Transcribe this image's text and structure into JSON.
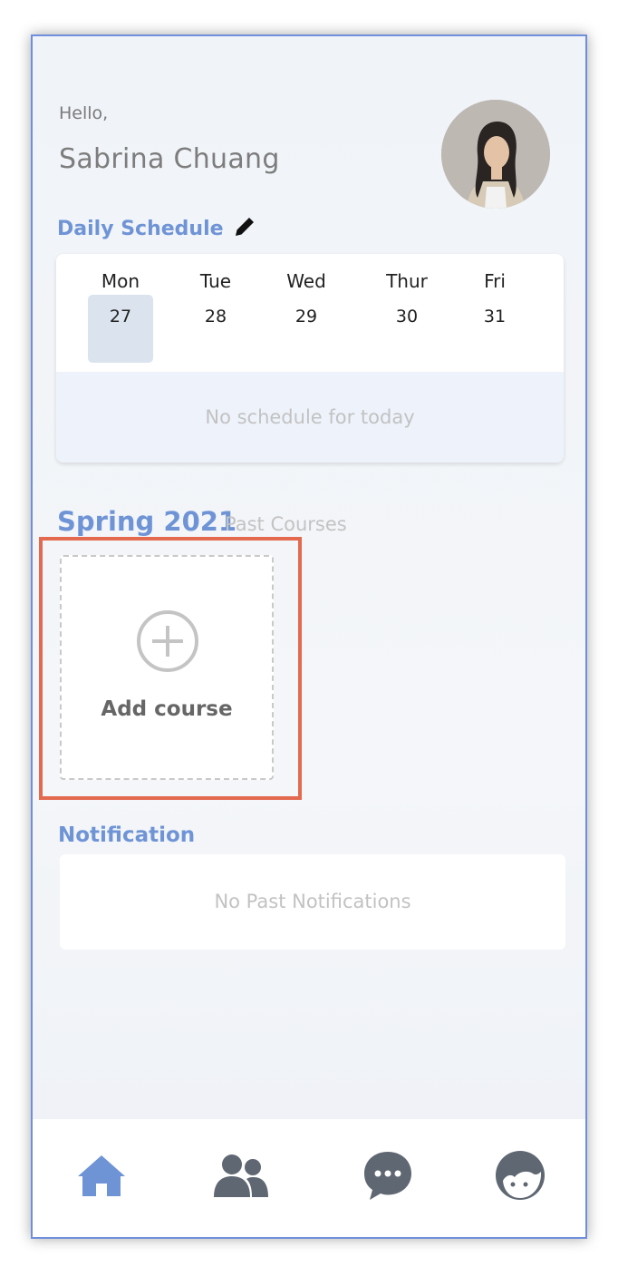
{
  "header": {
    "greeting": "Hello,",
    "user_name": "Sabrina Chuang"
  },
  "daily_schedule": {
    "title": "Daily Schedule",
    "days": [
      {
        "name": "Mon",
        "date": "27",
        "selected": true
      },
      {
        "name": "Tue",
        "date": "28",
        "selected": false
      },
      {
        "name": "Wed",
        "date": "29",
        "selected": false
      },
      {
        "name": "Thur",
        "date": "30",
        "selected": false
      },
      {
        "name": "Fri",
        "date": "31",
        "selected": false
      }
    ],
    "empty_message": "No schedule for today"
  },
  "courses": {
    "term": "Spring 2021",
    "past_link": "Past Courses",
    "add_label": "Add course"
  },
  "notifications": {
    "title": "Notification",
    "empty_message": "No Past Notifications"
  },
  "bottom_nav": {
    "items": [
      {
        "icon": "home-icon",
        "active": true
      },
      {
        "icon": "people-icon",
        "active": false
      },
      {
        "icon": "chat-icon",
        "active": false
      },
      {
        "icon": "profile-icon",
        "active": false
      }
    ]
  },
  "colors": {
    "accent": "#6f94d6",
    "highlight": "#e3694f",
    "nav_active": "#6f94d6",
    "nav_inactive": "#5f6772"
  }
}
